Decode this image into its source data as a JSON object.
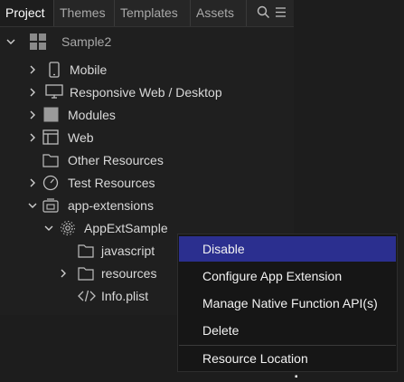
{
  "tabs": [
    {
      "label": "Project",
      "active": true
    },
    {
      "label": "Themes",
      "active": false
    },
    {
      "label": "Templates",
      "active": false
    },
    {
      "label": "Assets",
      "active": false
    }
  ],
  "tab_icons": [
    "search-icon",
    "list-icon"
  ],
  "tree": {
    "root": {
      "label": "Sample2",
      "icon": "grid-icon",
      "expanded": true
    },
    "items": [
      {
        "label": "Mobile",
        "icon": "phone-icon",
        "expanded": false
      },
      {
        "label": "Responsive Web / Desktop",
        "icon": "monitor-icon",
        "expanded": false
      },
      {
        "label": "Modules",
        "icon": "module-icon",
        "expanded": false
      },
      {
        "label": "Web",
        "icon": "web-icon",
        "expanded": false
      },
      {
        "label": "Other Resources",
        "icon": "folder-icon",
        "expanded": null
      },
      {
        "label": "Test Resources",
        "icon": "gauge-icon",
        "expanded": false
      },
      {
        "label": "app-extensions",
        "icon": "extension-icon",
        "expanded": true
      },
      {
        "label": "AppExtSample",
        "icon": "gear-icon",
        "expanded": true
      },
      {
        "label": "javascript",
        "icon": "folder-icon",
        "expanded": null
      },
      {
        "label": "resources",
        "icon": "folder-icon",
        "expanded": false
      },
      {
        "label": "Info.plist",
        "icon": "code-icon",
        "expanded": null
      }
    ]
  },
  "context_menu": {
    "items": [
      {
        "label": "Disable",
        "highlighted": true
      },
      {
        "label": "Configure App Extension",
        "highlighted": false
      },
      {
        "label": "Manage Native Function API(s)",
        "highlighted": false
      },
      {
        "label": "Delete",
        "highlighted": false
      },
      {
        "label": "Resource Location",
        "highlighted": false
      }
    ]
  },
  "colors": {
    "background": "#1d1d1d",
    "menu_background": "#161616",
    "menu_highlight": "#2b2f8f",
    "text": "#d9d9d9"
  }
}
